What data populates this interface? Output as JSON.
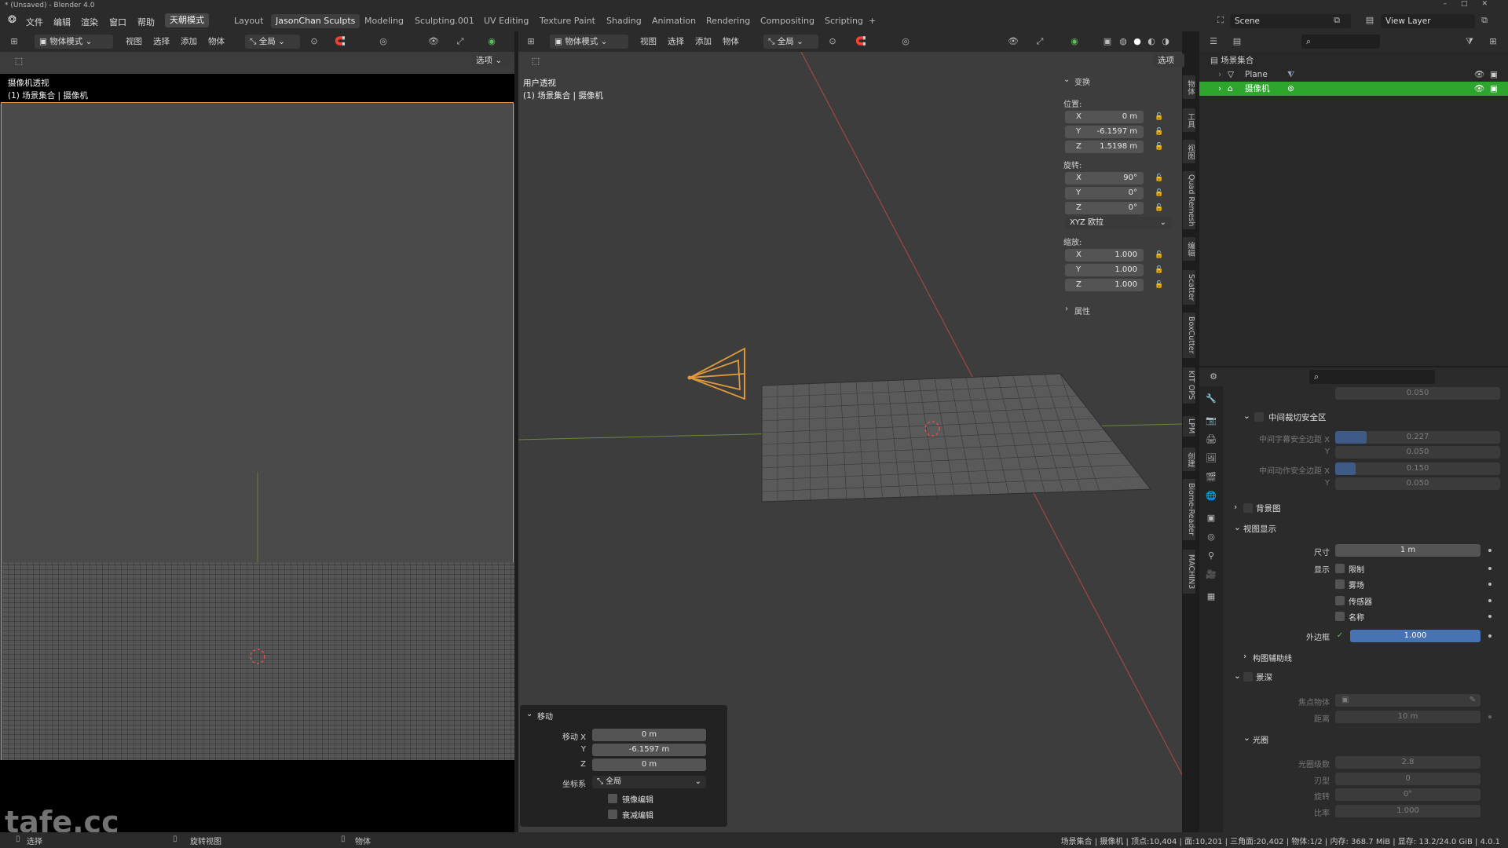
{
  "window": {
    "title": "* (Unsaved) - Blender 4.0",
    "controls": [
      "–",
      "□",
      "✕"
    ]
  },
  "menubar": {
    "menus": [
      "文件",
      "编辑",
      "渲染",
      "窗口",
      "帮助"
    ],
    "mode_button": "天朝模式",
    "workspaces": [
      "Layout",
      "JasonChan Sculpts",
      "Modeling",
      "Sculpting.001",
      "UV Editing",
      "Texture Paint",
      "Shading",
      "Animation",
      "Rendering",
      "Compositing",
      "Scripting",
      "+"
    ],
    "active_workspace": "JasonChan Sculpts",
    "scene": "Scene",
    "view_layer": "View Layer"
  },
  "left_viewport": {
    "mode": "物体模式",
    "menus": [
      "视图",
      "选择",
      "添加",
      "物体"
    ],
    "transform_orientation": "全局",
    "options": "选项",
    "title": "摄像机透视",
    "subtitle": "(1) 场景集合 | 摄像机"
  },
  "main_viewport": {
    "mode": "物体模式",
    "menus": [
      "视图",
      "选择",
      "添加",
      "物体"
    ],
    "transform_orientation": "全局",
    "options": "选项",
    "title": "用户透视",
    "subtitle": "(1) 场景集合 | 摄像机"
  },
  "n_panel": {
    "section": "变换",
    "location_label": "位置:",
    "location": [
      {
        "axis": "X",
        "value": "0 m"
      },
      {
        "axis": "Y",
        "value": "-6.1597 m"
      },
      {
        "axis": "Z",
        "value": "1.5198 m"
      }
    ],
    "rotation_label": "旋转:",
    "rotation": [
      {
        "axis": "X",
        "value": "90°"
      },
      {
        "axis": "Y",
        "value": "0°"
      },
      {
        "axis": "Z",
        "value": "0°"
      }
    ],
    "rotation_mode": "XYZ 欧拉",
    "scale_label": "缩放:",
    "scale": [
      {
        "axis": "X",
        "value": "1.000"
      },
      {
        "axis": "Y",
        "value": "1.000"
      },
      {
        "axis": "Z",
        "value": "1.000"
      }
    ],
    "properties_section": "属性"
  },
  "sidebar_tabs": [
    "物体",
    "工具",
    "视图",
    "Quad Remesh",
    "编辑",
    "Scatter",
    "BoxCutter",
    "KIT OPS",
    "LPM",
    "创建",
    "Biome-Reader",
    "MACHIN3"
  ],
  "outliner": {
    "root": "场景集合",
    "items": [
      {
        "name": "Plane",
        "selected": false
      },
      {
        "name": "摄像机",
        "selected": true
      }
    ]
  },
  "properties": {
    "top_y_value": "0.050",
    "center_cut_safe": {
      "title": "中间裁切安全区",
      "title_safe_label": "中间字幕安全边距 X",
      "title_safe_x": "0.227",
      "title_safe_y": "0.050",
      "action_safe_label": "中间动作安全边距 X",
      "action_safe_x": "0.150",
      "action_safe_y": "0.050",
      "y_label": "Y"
    },
    "background_images": "背景图",
    "viewport_display": {
      "title": "视图显示",
      "size_label": "尺寸",
      "size": "1 m",
      "show_label": "显示",
      "show_options": [
        "限制",
        "雾场",
        "传感器",
        "名称"
      ],
      "passepartout_label": "外边框",
      "passepartout": "1.000"
    },
    "composition_guides": "构图辅助线",
    "depth_of_field": {
      "title": "景深",
      "focus_object_label": "焦点物体",
      "distance_label": "距离",
      "distance": "10 m"
    },
    "aperture": {
      "title": "光圈",
      "fstop_label": "光圈级数",
      "fstop": "2.8",
      "blades_label": "刃型",
      "blades": "0",
      "rotation_label": "旋转",
      "rotation": "0°",
      "ratio_label": "比率",
      "ratio": "1.000"
    }
  },
  "operator_panel": {
    "title": "移动",
    "move_x_label": "移动 X",
    "move_x": "0 m",
    "y_label": "Y",
    "move_y": "-6.1597 m",
    "z_label": "Z",
    "move_z": "0 m",
    "orientation_label": "坐标系",
    "orientation": "全局",
    "checkbox1": "镜像编辑",
    "checkbox2": "衰减编辑"
  },
  "statusbar": {
    "left_items": [
      "选择",
      "旋转视图",
      "物体"
    ],
    "stats": "场景集合 | 摄像机 | 顶点:10,404 | 面:10,201 | 三角面:20,402 | 物体:1/2 | 内存: 368.7 MiB | 显存: 13.2/24.0 GiB | 4.0.1"
  },
  "watermark": "tafe.cc",
  "colors": {
    "selection_orange": "#e09a3c",
    "outliner_selected": "#2ea62e",
    "accent_blue": "#4772b3",
    "x_axis": "#b34a4a",
    "y_axis": "#7a9a3a"
  }
}
